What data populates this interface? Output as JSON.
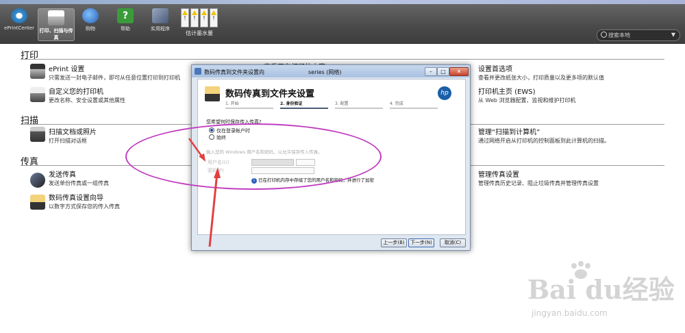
{
  "toolbar": {
    "buttons": [
      {
        "label": "ePrintCenter",
        "color": "#3a8fd0"
      },
      {
        "label": "打印、扫描与传真",
        "color": "#e8e8e8"
      },
      {
        "label": "购物",
        "color": "#3b6fbf"
      },
      {
        "label": "帮助",
        "color": "#3b9b3b"
      },
      {
        "label": "实用程序",
        "color": "#5a6b8a"
      }
    ],
    "ink_label": "估计墨水量",
    "ink_warning": "!",
    "search_placeholder": "搜索本地"
  },
  "sections": {
    "print": {
      "title": "打印",
      "items": [
        {
          "title": "ePrint 设置",
          "desc": "只需发送一封电子邮件，即可从任意位置打印到打印机"
        },
        {
          "title": "自定义您的打印机",
          "desc": "更改名称、安全设置或其他属性"
        },
        {
          "title": "查看正在打印的内容",
          "desc": ""
        },
        {
          "title": "设置首选项",
          "desc": "查看并更改纸张大小，打印质量以及更多项的默认值"
        },
        {
          "title": "打印机主页 (EWS)",
          "desc": "从 Web 浏览器配置、监视和维护打印机"
        }
      ]
    },
    "scan": {
      "title": "扫描",
      "items": [
        {
          "title": "扫描文档或照片",
          "desc": "打开扫描对话框"
        },
        {
          "title": "管理“扫描到计算机”",
          "desc": "通过网络开启从打印机的控制面板到此计算机的扫描。"
        }
      ]
    },
    "fax": {
      "title": "传真",
      "items": [
        {
          "title": "发送传真",
          "desc": "发送单份传真或一组传真"
        },
        {
          "title": "数码传真设置向导",
          "desc": "以数字方式保存您的传入传真"
        },
        {
          "title": "管理传真设置",
          "desc": "管理传真历史记录、阻止垃圾传真并管理传真设置"
        }
      ]
    }
  },
  "dialog": {
    "title": "数码传真到文件夹设置向",
    "series": "series (网络)",
    "min": "–",
    "max": "□",
    "close": "✕",
    "heading": "数码传真到文件夹设置",
    "hp_logo": "hp",
    "steps": [
      "1. 开始",
      "2. 身份验证",
      "3. 配置",
      "4. 完成"
    ],
    "question": "您希望何时保存传入传真?",
    "options": [
      "仅在登录帐户时",
      "始终"
    ],
    "hint": "输入您的 Windows 用户名和密码，以允许保存传入传真。",
    "username_label": "用户名(U)",
    "password_label": "密码(P)",
    "info_icon": "i",
    "info_text": "已在打印机内存中存储了您的用户名和密码，并进行了加密",
    "back_button": "上一步(B)",
    "next_button": "下一步(N)",
    "cancel_button": "取消(C)"
  },
  "watermark": {
    "text": "Bai du经验",
    "url": "jingyan.baidu.com"
  },
  "colors": {
    "annotation": "#c03cc0",
    "arrow": "#e04040"
  }
}
